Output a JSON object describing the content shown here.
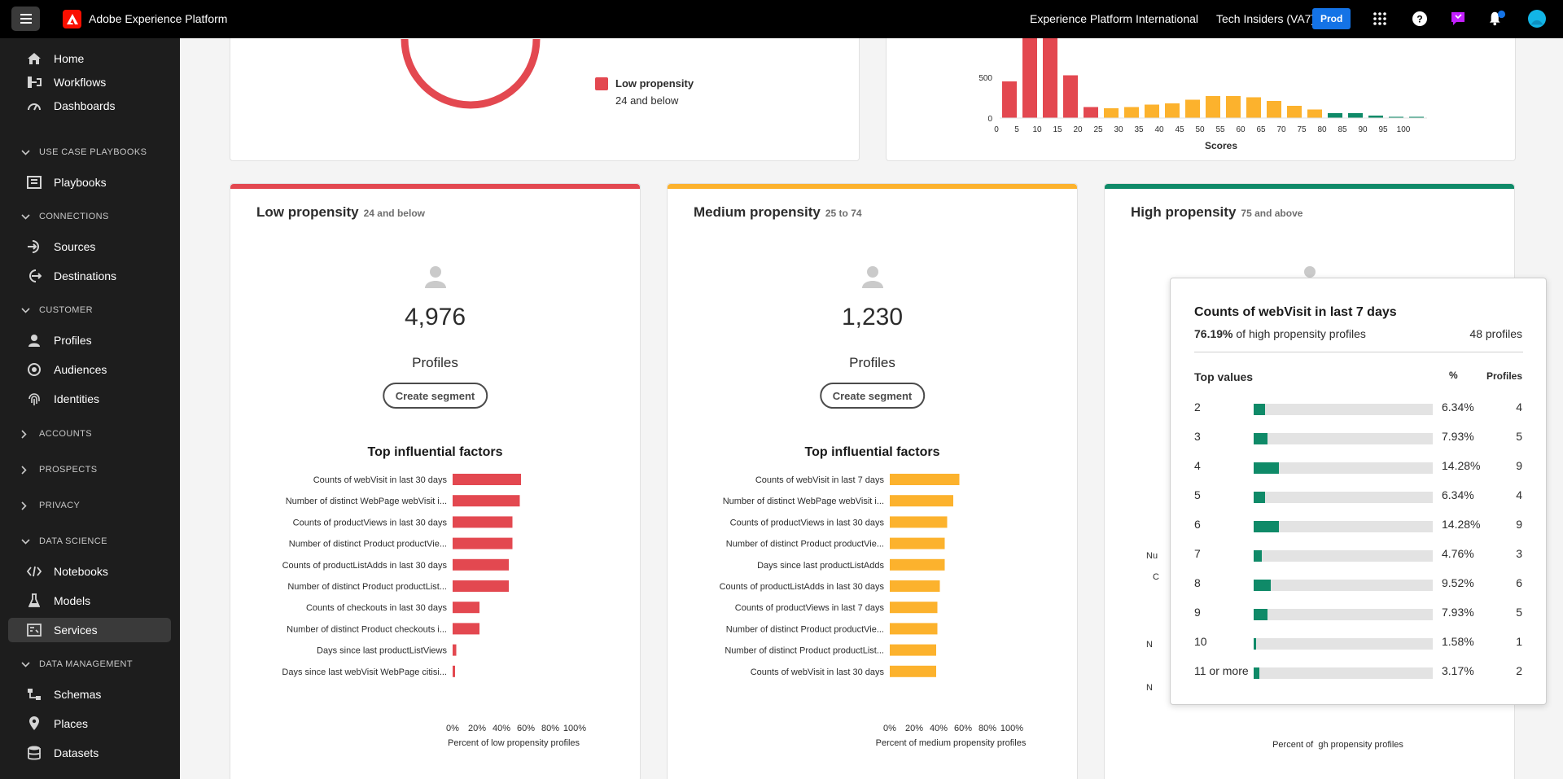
{
  "header": {
    "app_name": "Adobe Experience Platform",
    "org": "Experience Platform International",
    "sandbox": "Tech Insiders (VA7)",
    "env_badge": "Prod"
  },
  "sidebar": {
    "items": [
      {
        "label": "Home",
        "icon": "home-icon"
      },
      {
        "label": "Workflows",
        "icon": "workflow-icon"
      },
      {
        "label": "Dashboards",
        "icon": "dashboard-icon"
      },
      {
        "section": "USE CASE PLAYBOOKS"
      },
      {
        "label": "Playbooks",
        "icon": "playbook-icon"
      },
      {
        "section": "CONNECTIONS"
      },
      {
        "label": "Sources",
        "icon": "source-icon"
      },
      {
        "label": "Destinations",
        "icon": "destination-icon"
      },
      {
        "section": "CUSTOMER"
      },
      {
        "label": "Profiles",
        "icon": "profile-icon"
      },
      {
        "label": "Audiences",
        "icon": "audience-icon"
      },
      {
        "label": "Identities",
        "icon": "fingerprint-icon"
      },
      {
        "section": "ACCOUNTS",
        "collapsed": true
      },
      {
        "section": "PROSPECTS",
        "collapsed": true
      },
      {
        "section": "PRIVACY",
        "collapsed": true
      },
      {
        "section": "DATA SCIENCE"
      },
      {
        "label": "Notebooks",
        "icon": "code-icon"
      },
      {
        "label": "Models",
        "icon": "beaker-icon"
      },
      {
        "label": "Services",
        "icon": "services-icon",
        "active": true
      },
      {
        "section": "DATA MANAGEMENT"
      },
      {
        "label": "Schemas",
        "icon": "schema-icon"
      },
      {
        "label": "Places",
        "icon": "pin-icon"
      },
      {
        "label": "Datasets",
        "icon": "dataset-icon"
      }
    ]
  },
  "legend_top": {
    "label": "Low propensity",
    "range": "24 and below",
    "color": "#e34850"
  },
  "histogram": {
    "xlabel": "Scores",
    "y_ticks": [
      "500",
      "0"
    ],
    "x_ticks": [
      "0",
      "5",
      "10",
      "15",
      "20",
      "25",
      "30",
      "35",
      "40",
      "45",
      "50",
      "55",
      "60",
      "65",
      "70",
      "75",
      "80",
      "85",
      "90",
      "95",
      "100"
    ],
    "bar_heights_pct": [
      30,
      95,
      92,
      35,
      9,
      8,
      9,
      11,
      12,
      15,
      18,
      18,
      17,
      14,
      10,
      7,
      4,
      4,
      2,
      1,
      1
    ],
    "bar_colors": [
      "#e34850",
      "#e34850",
      "#e34850",
      "#e34850",
      "#e34850",
      "#fcb22d",
      "#fcb22d",
      "#fcb22d",
      "#fcb22d",
      "#fcb22d",
      "#fcb22d",
      "#fcb22d",
      "#fcb22d",
      "#fcb22d",
      "#fcb22d",
      "#fcb22d",
      "#0f8a68",
      "#0f8a68",
      "#0f8a68",
      "#0f8a68",
      "#0f8a68"
    ]
  },
  "panels": [
    {
      "title": "Low propensity",
      "range": "24 and below",
      "color": "#e34850",
      "count": "4,976",
      "count_label": "Profiles",
      "button": "Create segment",
      "chart_title": "Top influential factors",
      "xlabel": "Percent of low propensity profiles",
      "x_ticks": [
        "0%",
        "20%",
        "40%",
        "60%",
        "80%",
        "100%"
      ],
      "factors": [
        {
          "label": "Counts of webVisit in last 30 days",
          "value": 56
        },
        {
          "label": "Number of distinct WebPage webVisit i...",
          "value": 55
        },
        {
          "label": "Counts of productViews in last 30 days",
          "value": 49
        },
        {
          "label": "Number of distinct Product productVie...",
          "value": 49
        },
        {
          "label": "Counts of productListAdds in last 30 days",
          "value": 46
        },
        {
          "label": "Number of distinct Product productList...",
          "value": 46
        },
        {
          "label": "Counts of checkouts in last 30 days",
          "value": 22
        },
        {
          "label": "Number of distinct Product checkouts i...",
          "value": 22
        },
        {
          "label": "Days since last productListViews",
          "value": 3
        },
        {
          "label": "Days since last webVisit WebPage citisi...",
          "value": 2
        }
      ]
    },
    {
      "title": "Medium propensity",
      "range": "25 to 74",
      "color": "#fcb22d",
      "count": "1,230",
      "count_label": "Profiles",
      "button": "Create segment",
      "chart_title": "Top influential factors",
      "xlabel": "Percent of medium propensity profiles",
      "x_ticks": [
        "0%",
        "20%",
        "40%",
        "60%",
        "80%",
        "100%"
      ],
      "factors": [
        {
          "label": "Counts of webVisit in last 7 days",
          "value": 57
        },
        {
          "label": "Number of distinct WebPage webVisit i...",
          "value": 52
        },
        {
          "label": "Counts of productViews in last 30 days",
          "value": 47
        },
        {
          "label": "Number of distinct Product productVie...",
          "value": 45
        },
        {
          "label": "Days since last productListAdds",
          "value": 45
        },
        {
          "label": "Counts of productListAdds in last 30 days",
          "value": 41
        },
        {
          "label": "Counts of productViews in last 7 days",
          "value": 39
        },
        {
          "label": "Number of distinct Product productVie...",
          "value": 39
        },
        {
          "label": "Number of distinct Product productList...",
          "value": 38
        },
        {
          "label": "Counts of webVisit in last 30 days",
          "value": 38
        }
      ]
    },
    {
      "title": "High propensity",
      "range": "75 and above",
      "color": "#0f8a68"
    }
  ],
  "popover": {
    "title": "Counts of webVisit in last 7 days",
    "pct_bold": "76.19%",
    "pct_text": "of high propensity profiles",
    "profiles": "48 profiles",
    "col_top": "Top values",
    "col_pct": "%",
    "col_profiles": "Profiles",
    "rows": [
      {
        "value": "2",
        "pct": "6.34%",
        "pct_num": 6.34,
        "profiles": "4"
      },
      {
        "value": "3",
        "pct": "7.93%",
        "pct_num": 7.93,
        "profiles": "5"
      },
      {
        "value": "4",
        "pct": "14.28%",
        "pct_num": 14.28,
        "profiles": "9"
      },
      {
        "value": "5",
        "pct": "6.34%",
        "pct_num": 6.34,
        "profiles": "4"
      },
      {
        "value": "6",
        "pct": "14.28%",
        "pct_num": 14.28,
        "profiles": "9"
      },
      {
        "value": "7",
        "pct": "4.76%",
        "pct_num": 4.76,
        "profiles": "3"
      },
      {
        "value": "8",
        "pct": "9.52%",
        "pct_num": 9.52,
        "profiles": "6"
      },
      {
        "value": "9",
        "pct": "7.93%",
        "pct_num": 7.93,
        "profiles": "5"
      },
      {
        "value": "10",
        "pct": "1.58%",
        "pct_num": 1.58,
        "profiles": "1"
      },
      {
        "value": "11 or more",
        "pct": "3.17%",
        "pct_num": 3.17,
        "profiles": "2"
      }
    ]
  },
  "hidden_fragments": {
    "n1": "Nu",
    "c1": "C",
    "n2": "N",
    "n3": "N",
    "axis_fragment": "Percent of  gh propensity profiles"
  }
}
